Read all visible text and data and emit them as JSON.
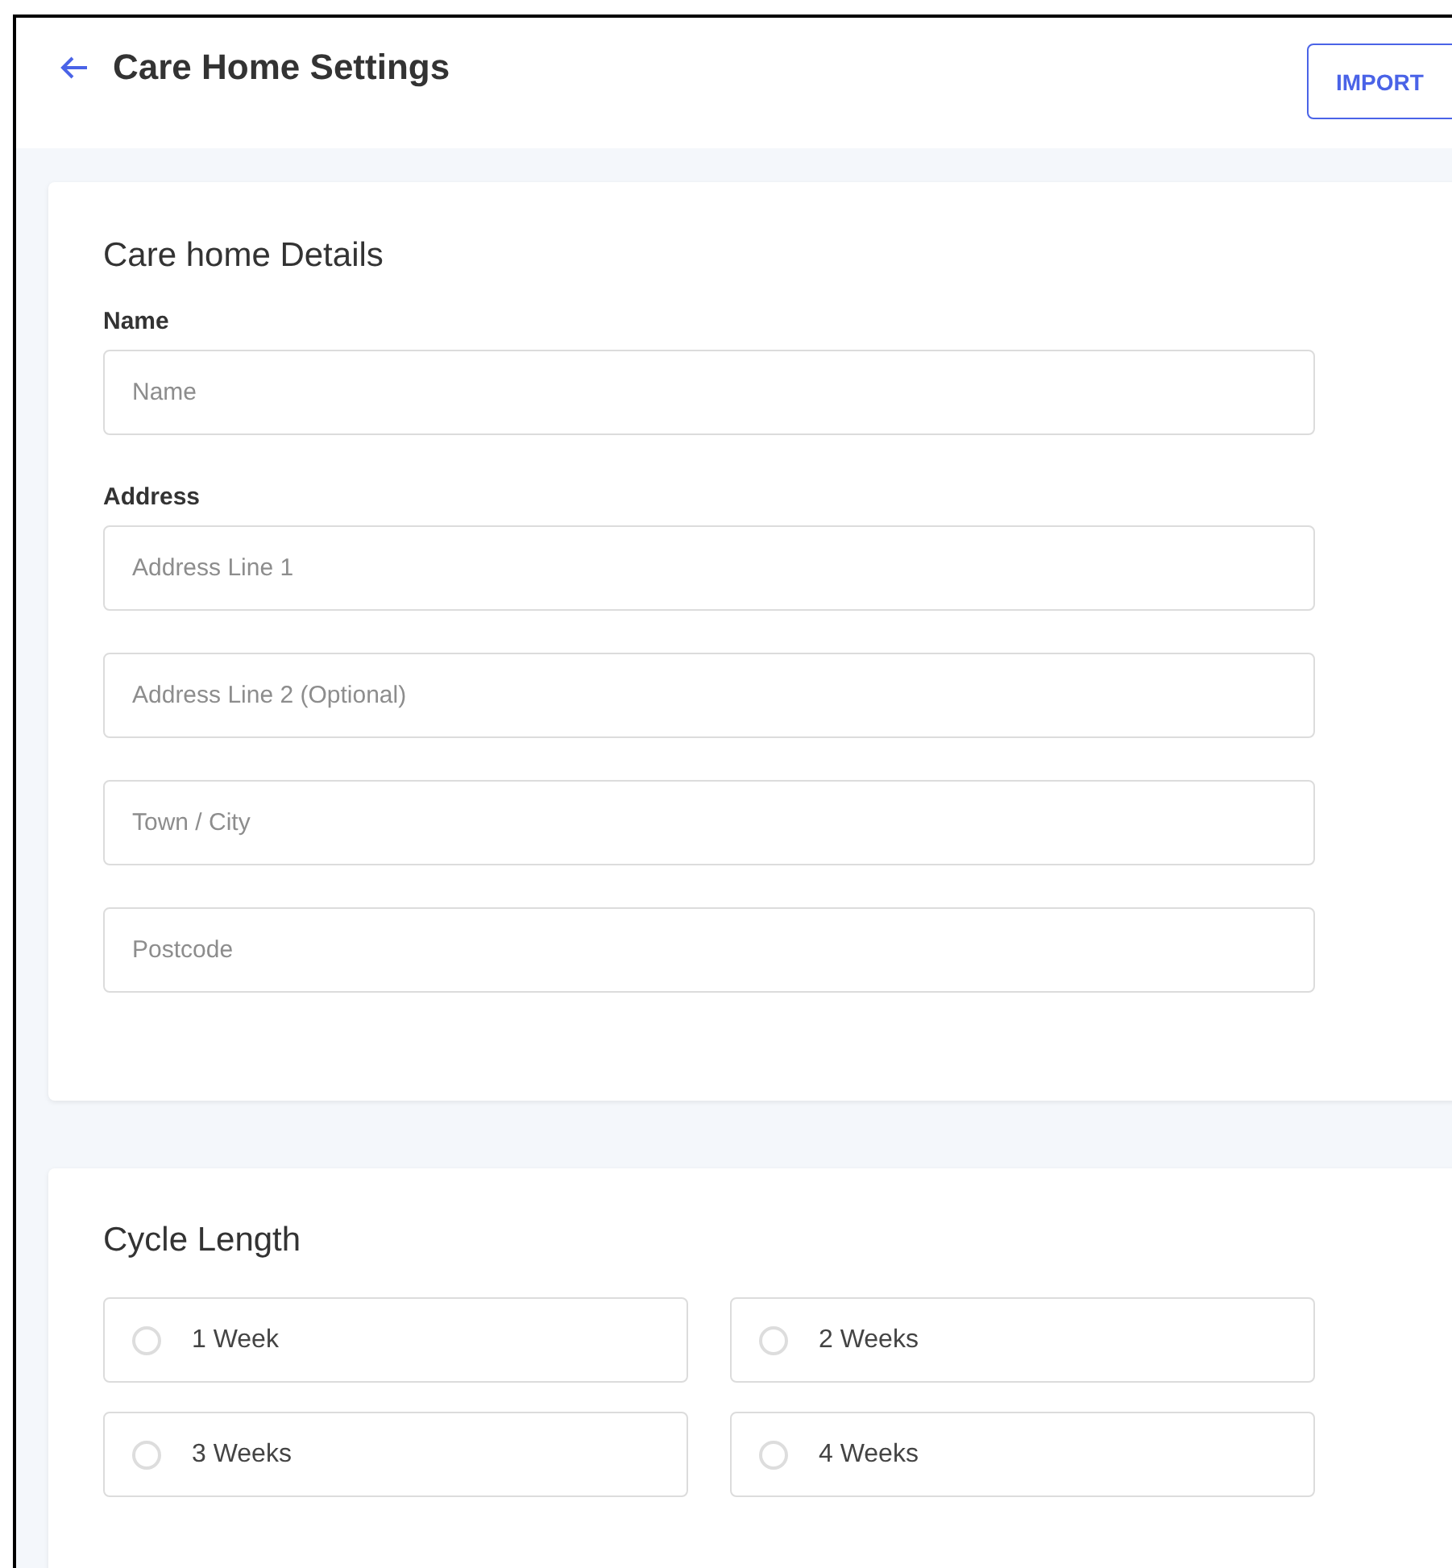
{
  "header": {
    "title": "Care Home Settings",
    "import_button": "IMPORT"
  },
  "details": {
    "title": "Care home Details",
    "name_label": "Name",
    "name_field": {
      "placeholder": "Name"
    },
    "address_label": "Address",
    "address_fields": [
      {
        "placeholder": "Address Line 1"
      },
      {
        "placeholder": "Address Line 2 (Optional)"
      },
      {
        "placeholder": "Town / City"
      },
      {
        "placeholder": "Postcode"
      }
    ]
  },
  "cycle_length": {
    "title": "Cycle Length",
    "options": [
      {
        "label": "1 Week",
        "selected": false
      },
      {
        "label": "2 Weeks",
        "selected": false
      },
      {
        "label": "3 Weeks",
        "selected": false
      },
      {
        "label": "4 Weeks",
        "selected": false
      }
    ]
  }
}
